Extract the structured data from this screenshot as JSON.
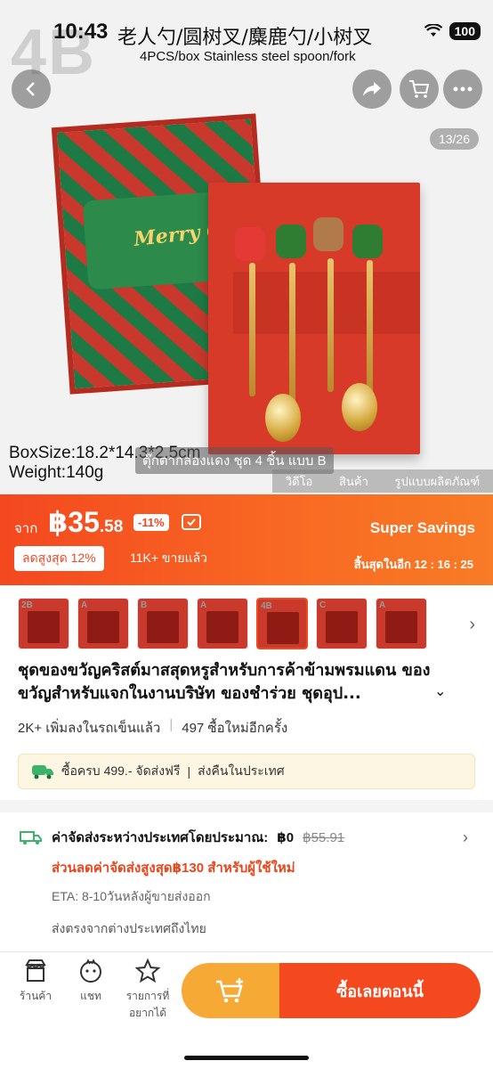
{
  "status": {
    "time": "10:43",
    "battery": "100"
  },
  "hero": {
    "watermark": "4B",
    "title_cn": "老人勺/圆树叉/麋鹿勺/小树叉",
    "subtitle": "4PCS/box Stainless steel spoon/fork",
    "counter": "13/26",
    "box_size": "BoxSize:18.2*14.3*2.5cm",
    "weight": "Weight:140g",
    "variant_caption": "ตุ๊กตากล่องแดง ชุด 4 ชิ้น แบบ B",
    "tabs": [
      "วิดีโอ",
      "สินค้า",
      "รูปแบบผลิตภัณฑ์"
    ]
  },
  "price": {
    "from_label": "จาก",
    "currency": "฿",
    "whole": "35",
    "decimal": ".58",
    "discount": "-11%",
    "super_savings": "Super Savings",
    "max_discount": "ลดสูงสุด 12%",
    "sold": "11K+ ขายแล้ว",
    "ends_in": "สิ้นสุดในอีก 12 : 16 : 25"
  },
  "thumbs": [
    {
      "label": "2B",
      "selected": false
    },
    {
      "label": "A",
      "selected": false
    },
    {
      "label": "B",
      "selected": false
    },
    {
      "label": "A",
      "selected": false
    },
    {
      "label": "4B",
      "selected": true
    },
    {
      "label": "C",
      "selected": false
    },
    {
      "label": "A",
      "selected": false
    }
  ],
  "product": {
    "title": "ชุดของขวัญคริสต์มาสสุดหรูสำหรับการค้าข้ามพรมแดน ของขวัญสำหรับแจกในงานบริษัท ของชำร่วย ชุดอุป...",
    "cart_adds": "2K+ เพิ่มลงในรถเข็นแล้ว",
    "repurchase": "497 ซื้อใหม่อีกครั้ง"
  },
  "promo": {
    "free_shipping": "ซื้อครบ 499.- จัดส่งฟรี",
    "returns": "ส่งคืนในประเทศ"
  },
  "shipping": {
    "label": "ค่าจัดส่งระหว่างประเทศโดยประมาณ:",
    "price": "฿0",
    "original": "฿55.91",
    "promo": "ส่วนลดค่าจัดส่งสูงสุด฿130 สำหรับผู้ใช้ใหม่",
    "eta": "ETA: 8-10วันหลังผู้ขายส่งออก",
    "direct": "ส่งตรงจากต่างประเทศถึงไทย"
  },
  "bottom": {
    "store": "ร้านค้า",
    "chat": "แชท",
    "wishlist_line1": "รายการที่",
    "wishlist_line2": "อยากได้",
    "buy_now": "ซื้อเลยตอนนี้"
  },
  "colors": {
    "primary": "#f4481f",
    "cart": "#f7a935",
    "promo_bg": "#fdf6e3"
  }
}
